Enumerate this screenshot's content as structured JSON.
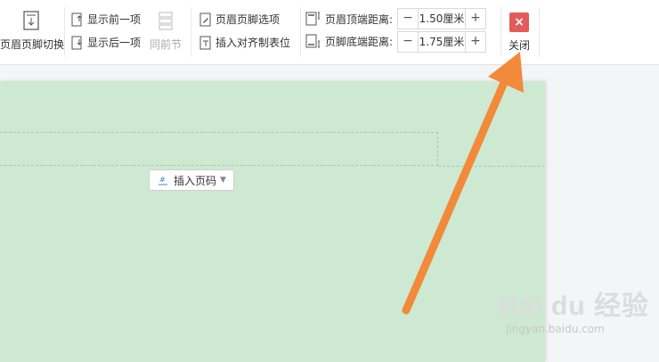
{
  "toolbar": {
    "switch_label": "页眉页脚切换",
    "show_prev_label": "显示前一项",
    "show_next_label": "显示后一项",
    "same_prev_label": "同前节",
    "hf_options_label": "页眉页脚选项",
    "insert_align_tab_label": "插入对齐制表位",
    "header_top_label": "页眉顶端距离:",
    "header_top_value": "1.50厘米",
    "footer_bottom_label": "页脚底端距离:",
    "footer_bottom_value": "1.75厘米",
    "minus": "−",
    "plus": "+",
    "close_x": "×",
    "close_label": "关闭"
  },
  "page": {
    "insert_page_number_label": "插入页码"
  },
  "watermark": {
    "brand": "Bai du 经验",
    "domain": "jingyan.baidu.com"
  },
  "colors": {
    "page_green": "#cde9d1",
    "close_red": "#e25b5b",
    "arrow_orange": "#f28a3a"
  }
}
